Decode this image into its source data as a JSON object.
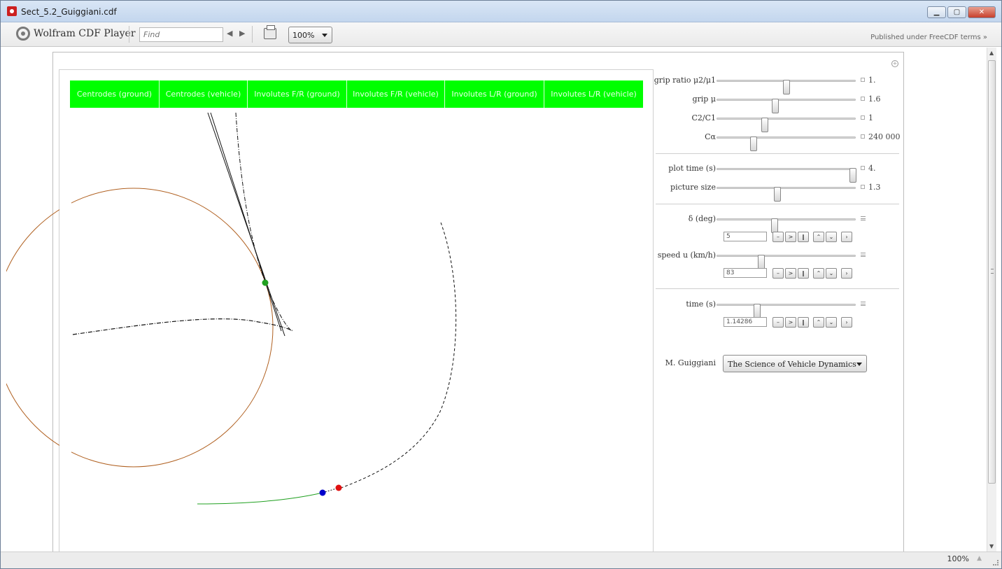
{
  "window": {
    "title": "Sect_5.2_Guiggiani.cdf"
  },
  "toolbar": {
    "app_name": "Wolfram CDF Player",
    "find_placeholder": "Find",
    "nav_arrows": "◀ ▶",
    "zoom": "100%",
    "published": "Published under FreeCDF terms »"
  },
  "tabs": [
    {
      "label": "Centrodes (ground)"
    },
    {
      "label": "Centrodes (vehicle)"
    },
    {
      "label": "Involutes F/R (ground)"
    },
    {
      "label": "Involutes F/R (vehicle)"
    },
    {
      "label": "Involutes L/R (ground)"
    },
    {
      "label": "Involutes L/R (vehicle)"
    }
  ],
  "tab_color": "#00ff00",
  "sliders_group1": [
    {
      "label": "grip ratio μ2/μ1",
      "value": "1.",
      "position": 0.5
    },
    {
      "label": "grip μ",
      "value": "1.6",
      "position": 0.42
    },
    {
      "label": "C2/C1",
      "value": "1",
      "position": 0.34
    },
    {
      "label": "Cα",
      "value": "240 000",
      "position": 0.26
    }
  ],
  "sliders_group2": [
    {
      "label": "plot time (s)",
      "value": "4.",
      "position": 0.98
    },
    {
      "label": "picture size",
      "value": "1.3",
      "position": 0.43
    }
  ],
  "animated_sliders": [
    {
      "label": "δ (deg)",
      "value": "5",
      "position": 0.41
    },
    {
      "label": "speed u (km/h)",
      "value": "83",
      "position": 0.31
    },
    {
      "label": "time (s)",
      "value": "1.14286",
      "position": 0.29
    }
  ],
  "anim_buttons": [
    "–",
    ">",
    "‖",
    "⌃",
    "⌄",
    "›"
  ],
  "reference": {
    "label": "M. Guiggiani",
    "selected": "The Science of Vehicle Dynamics"
  },
  "statusbar": {
    "zoom": "100%"
  },
  "colors": {
    "circle": "#b06020",
    "green_dot": "#20a020",
    "blue_dot": "#0000cc",
    "red_dot": "#e01010",
    "green_path": "#20a020"
  }
}
